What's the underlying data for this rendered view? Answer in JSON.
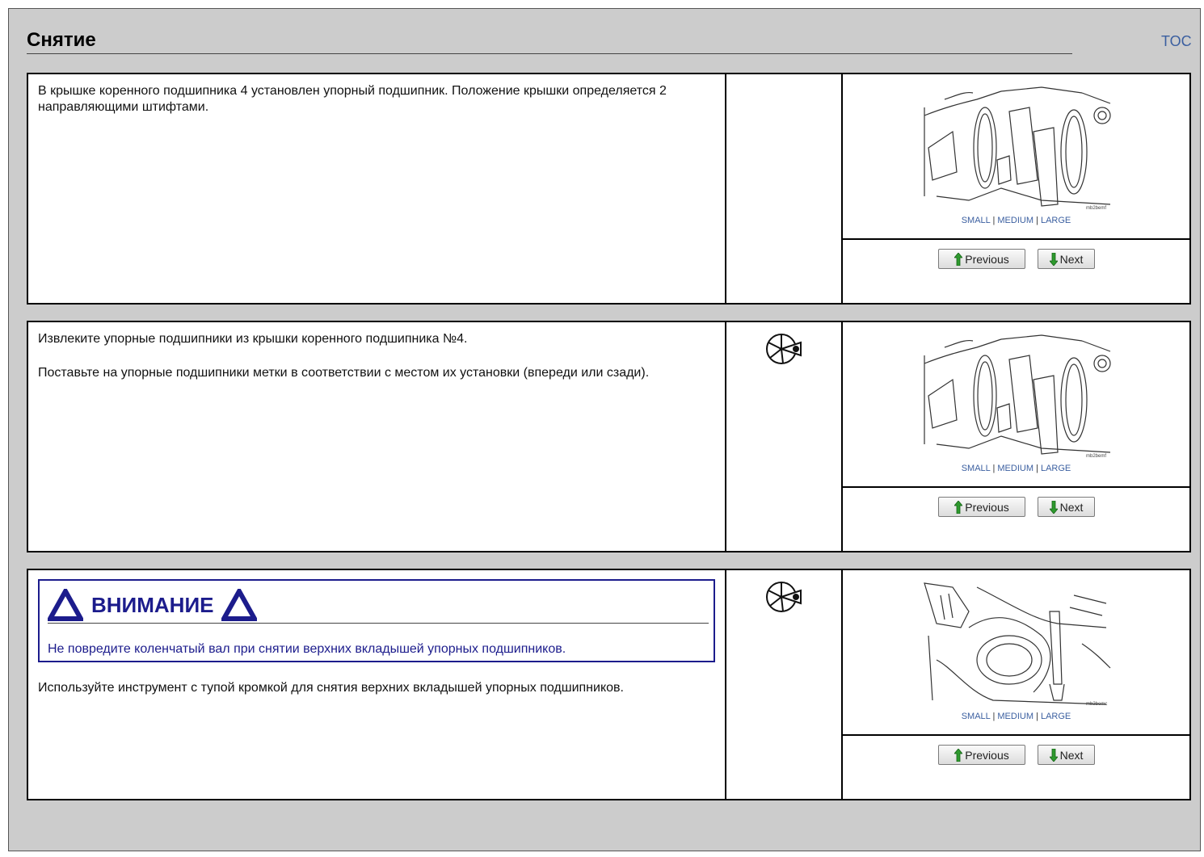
{
  "page": {
    "title": "Снятие",
    "toc_label": "TOC"
  },
  "image_links": {
    "small": "SMALL",
    "medium": "MEDIUM",
    "large": "LARGE",
    "separator": "|"
  },
  "nav": {
    "previous": "Previous",
    "next": "Next"
  },
  "steps": [
    {
      "paragraphs": [
        "В крышке коренного подшипника 4 установлен упорный подшипник. Положение крышки определяется 2 направляющими штифтами."
      ],
      "figure_code": "mb2bemf"
    },
    {
      "paragraphs": [
        "Извлеките упорные подшипники из крышки коренного подшипника №4.",
        "Поставьте на упорные подшипники метки в соответствии с местом их установки (впереди или сзади)."
      ],
      "figure_code": "mb2bemf"
    },
    {
      "warning": {
        "title": "ВНИМАНИЕ",
        "text": "Не повредите коленчатый вал при снятии верхних вкладышей упорных подшипников."
      },
      "paragraphs": [
        "Используйте инструмент с тупой кромкой для снятия верхних вкладышей упорных подшипников."
      ],
      "figure_code": "mb2bemc"
    }
  ],
  "colors": {
    "background": "#cccccc",
    "link": "#3b5fa0",
    "warning": "#1c1c8c"
  },
  "icons": {
    "tool": "tool-wheel-icon",
    "arrow_up": "green-arrow-up-icon",
    "arrow_down": "green-arrow-down-icon",
    "warning": "warning-triangle-icon"
  }
}
